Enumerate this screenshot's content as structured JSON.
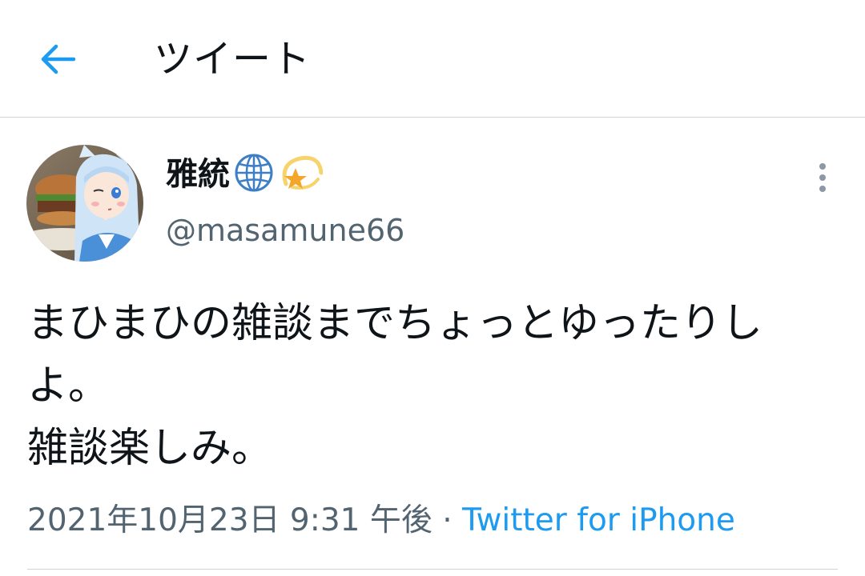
{
  "header": {
    "title": "ツイート",
    "back_icon": "arrow-left-icon",
    "accent_color": "#1d9bf0"
  },
  "tweet": {
    "author": {
      "display_name": "雅統",
      "handle": "@masamune66",
      "name_emojis": [
        "globe-icon",
        "dizzy-star-icon"
      ]
    },
    "text": "まひまひの雑談までちょっとゆったりしよ。\n雑談楽しみ。",
    "timestamp": "2021年10月23日 9:31 午後",
    "separator": "·",
    "source": "Twitter for iPhone"
  },
  "colors": {
    "text_primary": "#0f1419",
    "text_secondary": "#536471",
    "link": "#1d9bf0",
    "divider": "#d0d4d8"
  }
}
